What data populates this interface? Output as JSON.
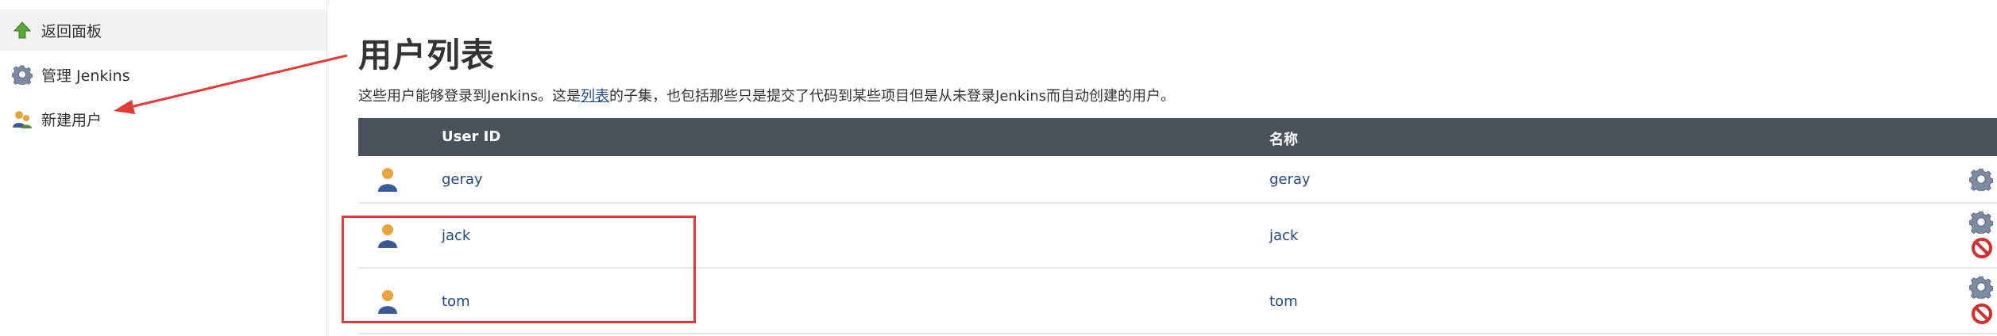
{
  "sidebar": {
    "items": [
      {
        "label": "返回面板",
        "icon": "up-arrow-icon"
      },
      {
        "label": "管理 Jenkins",
        "icon": "gear-icon"
      },
      {
        "label": "新建用户",
        "icon": "add-user-icon"
      }
    ]
  },
  "page": {
    "title": "用户列表",
    "desc_before": "这些用户能够登录到Jenkins。这是",
    "desc_link": "列表",
    "desc_after": "的子集，也包括那些只是提交了代码到某些项目但是从未登录Jenkins而自动创建的用户。"
  },
  "table": {
    "headers": {
      "user_id": "User ID",
      "name": "名称"
    },
    "rows": [
      {
        "user_id": "geray",
        "name": "geray",
        "deletable": false
      },
      {
        "user_id": "jack",
        "name": "jack",
        "deletable": true
      },
      {
        "user_id": "tom",
        "name": "tom",
        "deletable": true
      }
    ]
  },
  "colors": {
    "header_bg": "#4b525b",
    "link": "#204a87",
    "annotation": "#e53935"
  }
}
